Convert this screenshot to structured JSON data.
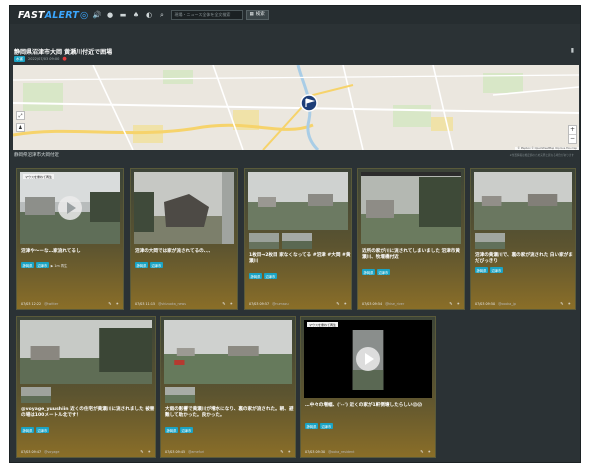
{
  "app": {
    "logo_main": "FAST",
    "logo_accent": "ALERT"
  },
  "toolbar": {
    "search_placeholder": "現場・ニュース全体を全文検索",
    "search_button": "検索",
    "icons": [
      "volume-icon",
      "chat-icon",
      "message-icon",
      "bell-icon",
      "contrast-icon"
    ]
  },
  "event": {
    "title": "静岡県沼津市大岡 黄瀬川付近で囲場",
    "badge": "水害",
    "time": "2022/07/03 09:00",
    "map_caption": "静岡県沼津市大岡付近",
    "map_note": "※位置情報は推定値のため実際と異なる場合があります",
    "attribution": "© Mapbox © OpenStreetMap Improve this map"
  },
  "cards": [
    {
      "text": "沼津や〜ーな…家流れてるし",
      "tags": [
        "静岡県",
        "沼津市"
      ],
      "extra": "▶ 1m 再生",
      "time": "07/03 12:22",
      "source": "@twitter",
      "video_label": "マウスを重ねて再生"
    },
    {
      "text": "沼津の大岡では家が流されてるの、、、",
      "tags": [
        "静岡県",
        "沼津市"
      ],
      "extra": "",
      "time": "07/03 11:15",
      "source": "@shizuoka_news"
    },
    {
      "text": "1枚目→2枚目 家なくなってる #沼津 #大岡 #黄瀬川",
      "tags": [
        "静岡県",
        "沼津市"
      ],
      "extra": "",
      "time": "07/03 09:57",
      "source": "@numazu"
    },
    {
      "text": "近所の家が川に流されてしまいました 沼津市黄瀬川、牧堰橋付近",
      "tags": [
        "静岡県",
        "沼津市"
      ],
      "extra": "",
      "time": "07/03 09:54",
      "source": "@kise_river"
    },
    {
      "text": "沼津の黄瀬川で、裏の家が流された 白い家がまだびっきり",
      "tags": [
        "静岡県",
        "沼津市"
      ],
      "extra": "",
      "time": "07/03 09:50",
      "source": "@oooka_jp"
    },
    {
      "text": "@voyage_yuushiin 近くの住宅が黄瀬川に流されました 被害の場は100メートル北です！",
      "tags": [
        "静岡県",
        "沼津市"
      ],
      "extra": "",
      "time": "07/03 09:47",
      "source": "@voyage"
    },
    {
      "text": "大雨の影響で黄瀬川が増水になり、裏の家が流された。朝、避難して助かった。良かった。",
      "tags": [
        "静岡県",
        "沼津市"
      ],
      "extra": "",
      "time": "07/03 09:45",
      "source": "@amefuri"
    },
    {
      "text": "…中々の増幅、('--') 近くの家が1軒倒壊したらしい😱😱",
      "tags": [
        "静岡県",
        "沼津市"
      ],
      "extra": "",
      "time": "07/03 09:30",
      "source": "@ooka_resident",
      "video_label": "マウスを重ねて再生"
    }
  ],
  "colors": {
    "accent": "#3ba7ff",
    "tag": "#1aa3c4",
    "panel": "#2b3235"
  }
}
